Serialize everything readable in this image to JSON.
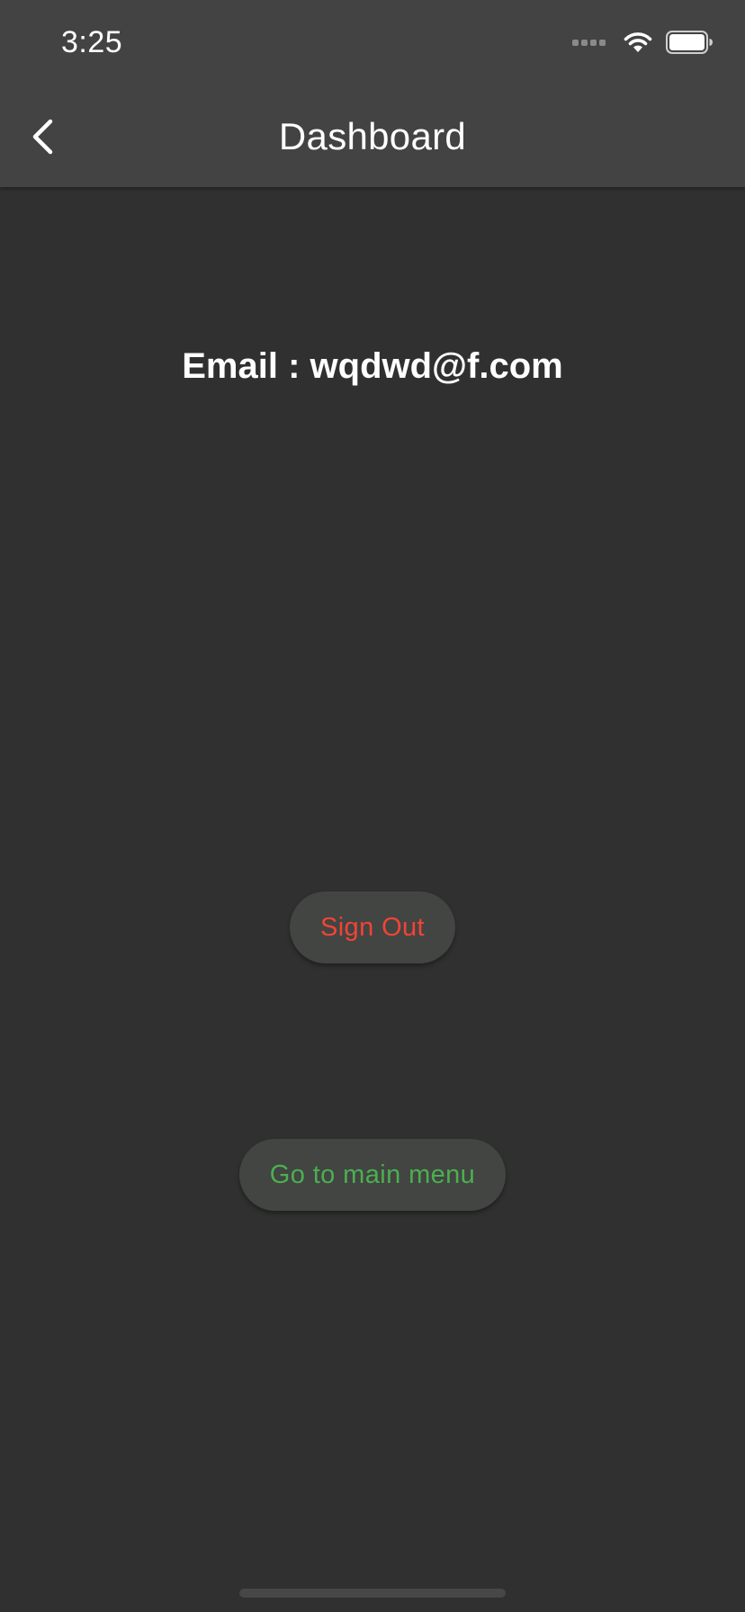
{
  "status_bar": {
    "time": "3:25",
    "icons": [
      "cellular-signal-icon",
      "wifi-icon",
      "battery-icon"
    ]
  },
  "app_bar": {
    "title": "Dashboard",
    "back_icon": "chevron-left-icon"
  },
  "main": {
    "email_text": "Email : wqdwd@f.com",
    "sign_out_label": "Sign Out",
    "main_menu_label": "Go to main menu"
  },
  "colors": {
    "background": "#303030",
    "app_bar": "#434343",
    "button_background": "#424542",
    "sign_out_text": "#f44336",
    "main_menu_text": "#4caf50"
  }
}
